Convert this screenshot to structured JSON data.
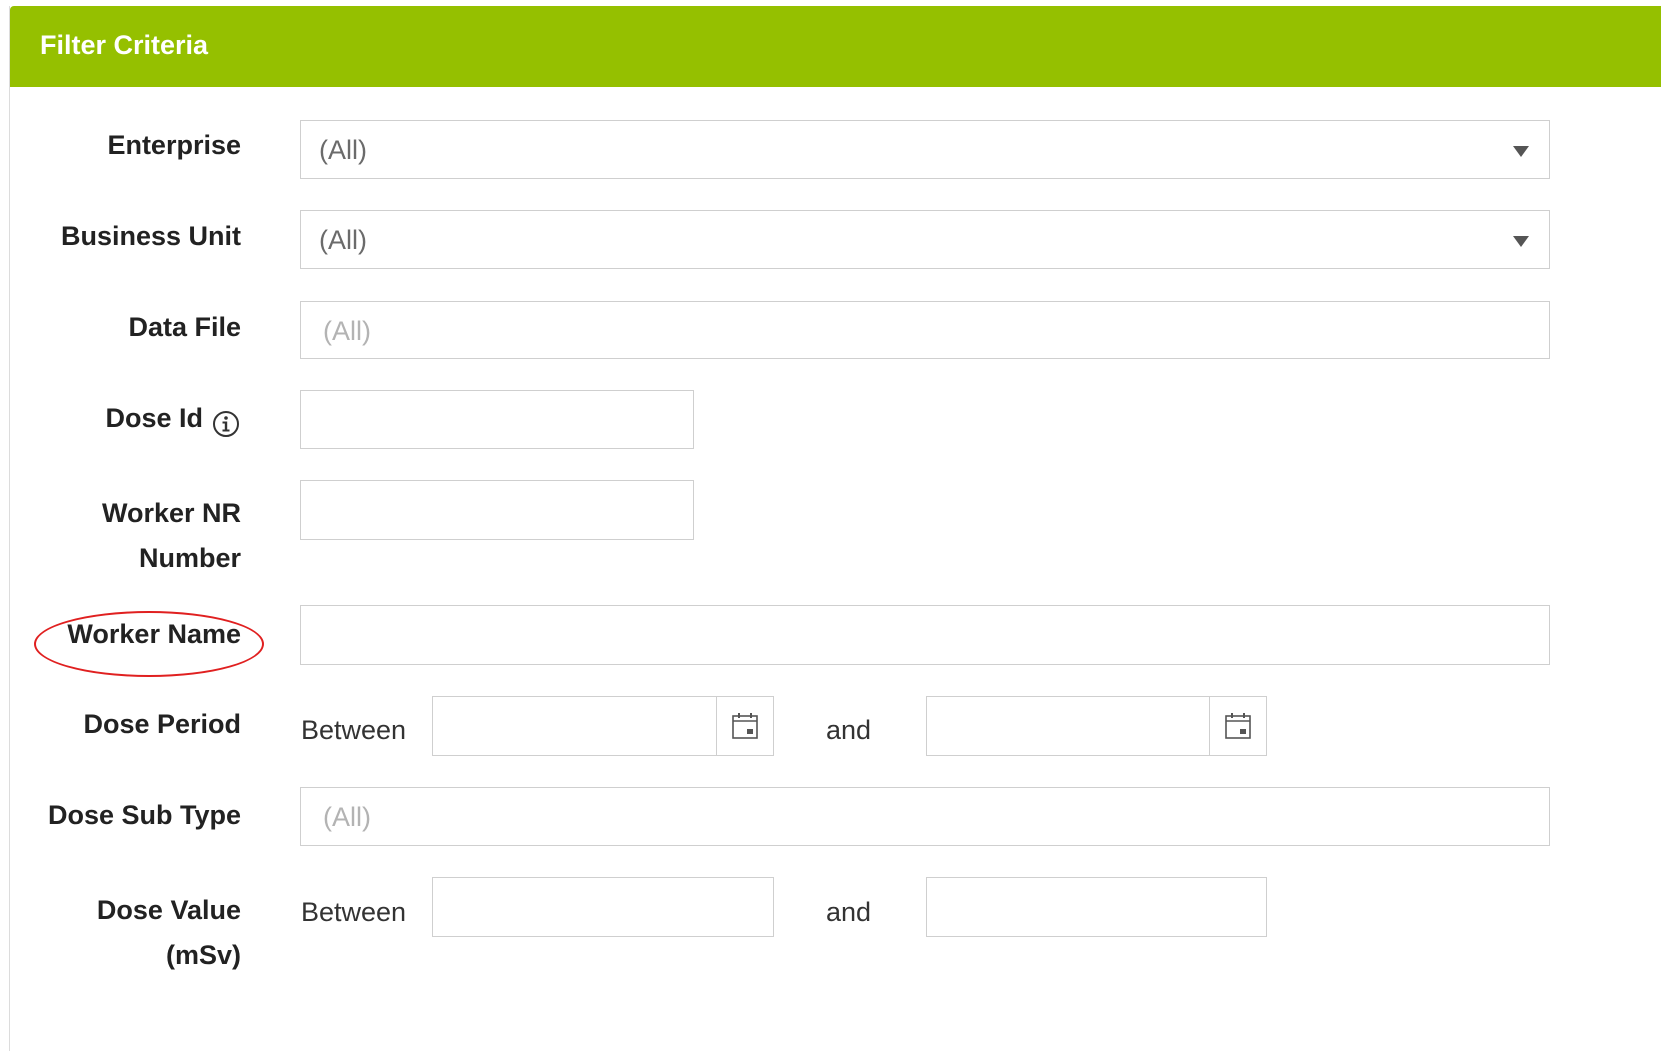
{
  "panel": {
    "title": "Filter Criteria",
    "colors": {
      "header_bg": "#95c000",
      "header_text": "#ffffff",
      "highlight": "#e02020"
    }
  },
  "fields": {
    "enterprise": {
      "label": "Enterprise",
      "value": "(All)"
    },
    "business_unit": {
      "label": "Business Unit",
      "value": "(All)"
    },
    "data_file": {
      "label": "Data File",
      "placeholder": "(All)"
    },
    "dose_id": {
      "label": "Dose Id",
      "value": ""
    },
    "worker_nr": {
      "label_line1": "Worker NR",
      "label_line2": "Number",
      "value": ""
    },
    "worker_name": {
      "label": "Worker Name",
      "value": ""
    },
    "dose_period": {
      "label": "Dose Period",
      "between": "Between",
      "and": "and",
      "from": "",
      "to": ""
    },
    "dose_sub_type": {
      "label": "Dose Sub Type",
      "placeholder": "(All)"
    },
    "dose_value": {
      "label_line1": "Dose Value",
      "label_line2": "(mSv)",
      "between": "Between",
      "and": "and",
      "from": "",
      "to": ""
    }
  },
  "icons": {
    "dropdown": "chevron-down-icon",
    "info": "info-icon",
    "calendar": "calendar-icon"
  }
}
